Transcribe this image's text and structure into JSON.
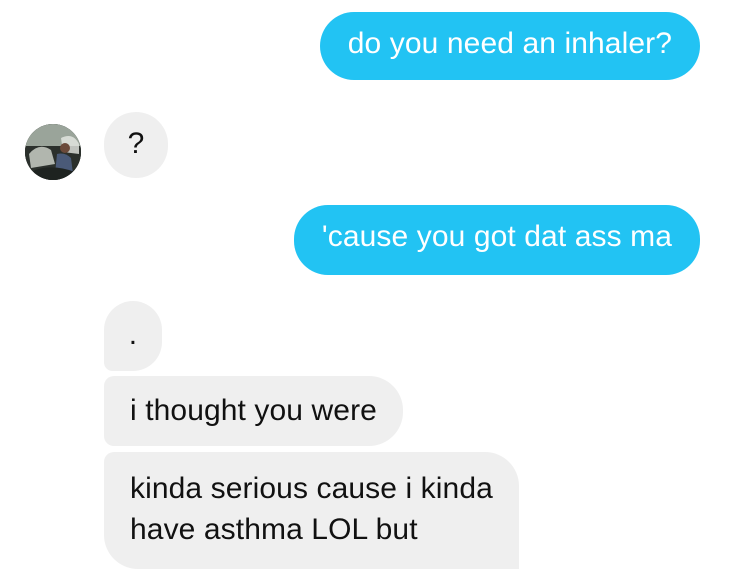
{
  "messages": [
    {
      "side": "outgoing",
      "text": "do you need an inhaler?"
    },
    {
      "side": "incoming",
      "text": "?"
    },
    {
      "side": "outgoing",
      "text": "'cause you got dat ass ma"
    },
    {
      "side": "incoming",
      "text": "."
    },
    {
      "side": "incoming",
      "text": "i thought you were"
    },
    {
      "side": "incoming",
      "lines": [
        "kinda serious cause i kinda",
        "have asthma LOL but"
      ]
    }
  ],
  "colors": {
    "outgoing_bubble": "#22c3f3",
    "incoming_bubble": "#efefef",
    "outgoing_text": "#ffffff",
    "incoming_text": "#111111"
  },
  "contact": {
    "avatar_icon": "user-avatar-photo"
  }
}
